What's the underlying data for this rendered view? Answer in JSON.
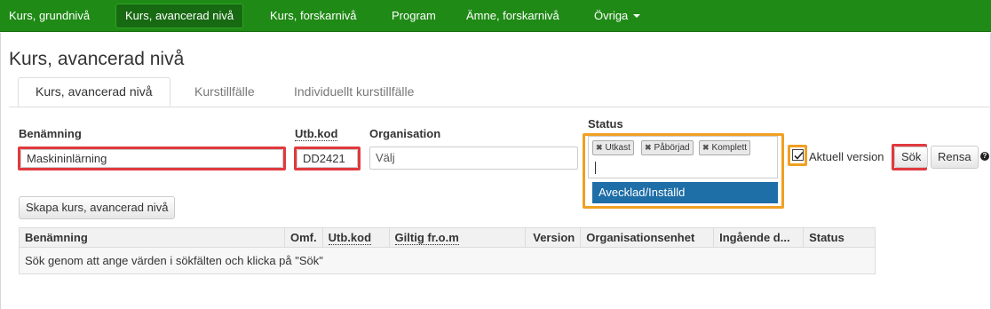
{
  "nav": {
    "items": [
      {
        "label": "Kurs, grundnivå"
      },
      {
        "label": "Kurs, avancerad nivå"
      },
      {
        "label": "Kurs, forskarnivå"
      },
      {
        "label": "Program"
      },
      {
        "label": "Ämne, forskarnivå"
      },
      {
        "label": "Övriga"
      }
    ],
    "active": "Kurs, avancerad nivå"
  },
  "page": {
    "title": "Kurs, avancerad nivå"
  },
  "tabs": [
    {
      "label": "Kurs, avancerad nivå"
    },
    {
      "label": "Kurstillfälle"
    },
    {
      "label": "Individuellt kurstillfälle"
    }
  ],
  "form": {
    "benamning": {
      "label": "Benämning",
      "value": "Maskininlärning"
    },
    "utbkod": {
      "label": "Utb.kod",
      "value": "DD2421"
    },
    "organisation": {
      "label": "Organisation",
      "placeholder": "Välj"
    },
    "status": {
      "label": "Status",
      "selected": [
        "Utkast",
        "Påbörjad",
        "Komplett"
      ],
      "dropdown_option": "Avecklad/Inställd"
    },
    "aktuell_version": {
      "label": "Aktuell version",
      "checked": true
    },
    "search_button": "Sök",
    "clear_button": "Rensa",
    "help_glyph": "?"
  },
  "create_button": "Skapa kurs, avancerad nivå",
  "table": {
    "columns": [
      "Benämning",
      "Omf.",
      "Utb.kod",
      "Giltig fr.o.m",
      "Version",
      "Organisationsenhet",
      "Ingående d...",
      "Status"
    ],
    "empty_message": "Sök genom att ange värden i sökfälten och klicka på \"Sök\""
  },
  "colors": {
    "nav_bg": "#1f8a16",
    "highlight_red": "#e03a3e",
    "highlight_orange": "#f0a022",
    "dropdown_selected": "#1e6ea7"
  }
}
